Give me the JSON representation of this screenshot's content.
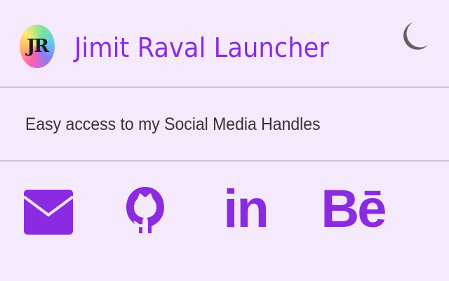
{
  "header": {
    "avatar_initials": "JR",
    "title": "Jimit Raval Launcher",
    "theme_toggle_icon": "moon-icon"
  },
  "main": {
    "subtitle": "Easy access to my Social Media Handles"
  },
  "social_links": [
    {
      "icon": "mail-icon"
    },
    {
      "icon": "github-icon"
    },
    {
      "icon": "linkedin-icon",
      "glyph": "in"
    },
    {
      "icon": "behance-icon",
      "glyph": "Bē"
    }
  ],
  "colors": {
    "background": "#f5e9fc",
    "accent": "#8a2be2",
    "divider": "#cfc3d8",
    "text": "#333333",
    "moon": "#616161"
  }
}
